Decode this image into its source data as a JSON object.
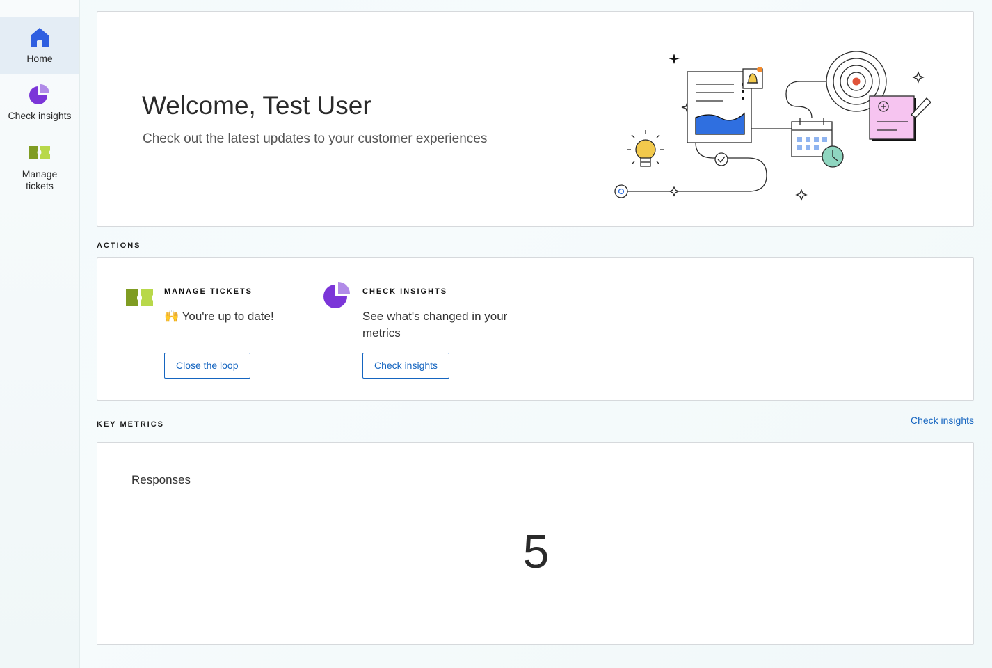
{
  "sidebar": {
    "items": [
      {
        "label": "Home",
        "icon": "home-icon",
        "active": true
      },
      {
        "label": "Check insights",
        "icon": "pie-chart-icon",
        "active": false
      },
      {
        "label": "Manage tickets",
        "icon": "ticket-icon",
        "active": false
      }
    ]
  },
  "welcome": {
    "title": "Welcome, Test User",
    "subtitle": "Check out the latest updates to your customer experiences"
  },
  "actions": {
    "section_title": "ACTIONS",
    "manage_tickets": {
      "heading": "MANAGE TICKETS",
      "text": "🙌 You're up to date!",
      "button_label": "Close the loop"
    },
    "check_insights": {
      "heading": "CHECK INSIGHTS",
      "text": "See what's changed in your metrics",
      "button_label": "Check insights"
    }
  },
  "key_metrics": {
    "section_title": "KEY METRICS",
    "link_label": "Check insights",
    "metric_label": "Responses",
    "metric_value": "5"
  },
  "colors": {
    "home_icon": "#2f5fe0",
    "insights_icon": "#7b35d8",
    "tickets_icon": "#93b82a",
    "link_blue": "#1565c0"
  }
}
